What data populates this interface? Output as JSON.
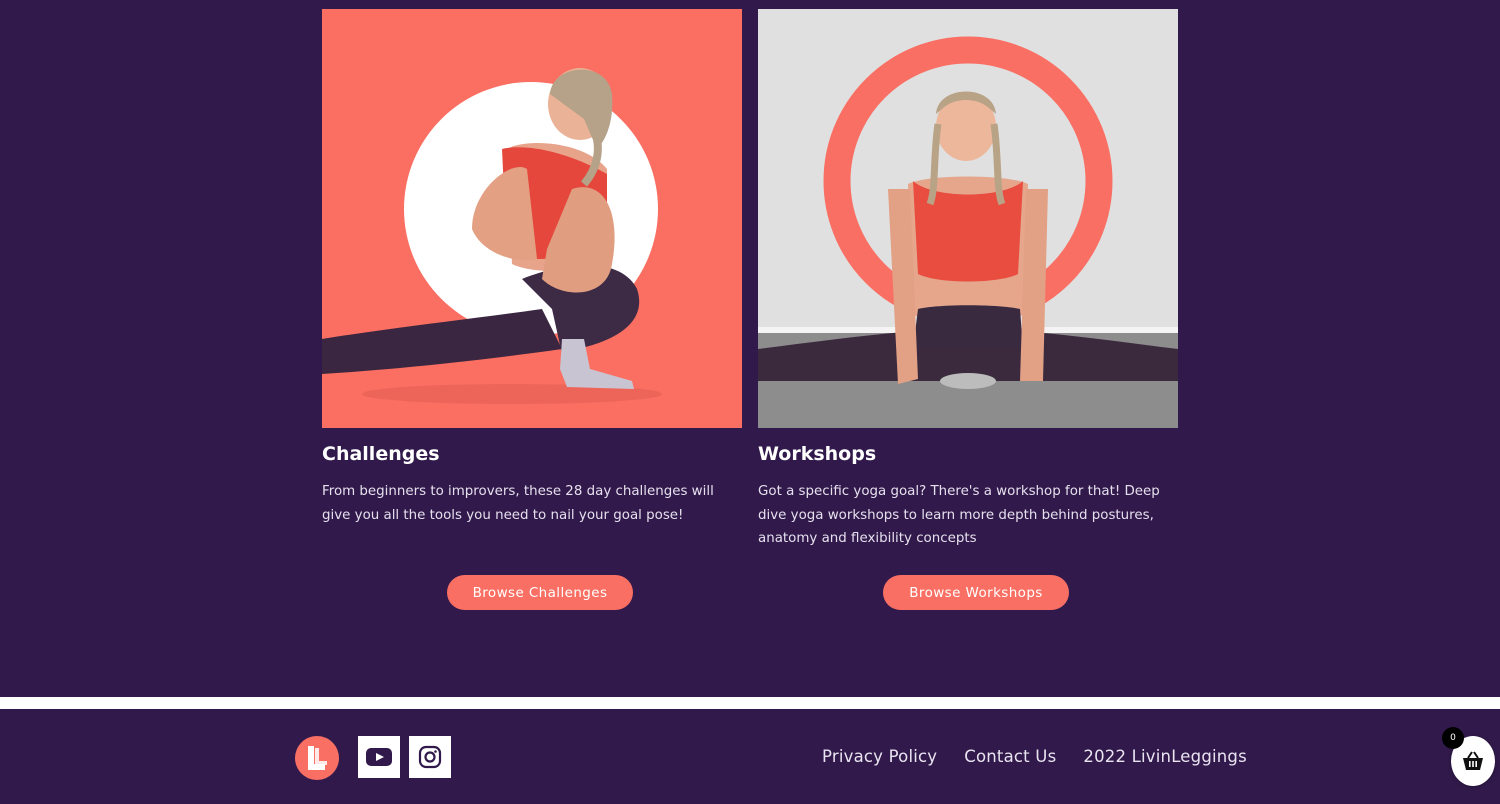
{
  "cards": [
    {
      "title": "Challenges",
      "description": "From beginners to improvers, these 28 day challenges will give you all the tools you need to nail your goal pose!",
      "button_label": "Browse Challenges"
    },
    {
      "title": "Workshops",
      "description": "Got a specific yoga goal? There's a workshop for that! Deep dive yoga workshops to learn more depth behind postures, anatomy and flexibility concepts",
      "button_label": "Browse Workshops"
    }
  ],
  "footer": {
    "logo_icon": "livinleggings-logo",
    "social": [
      {
        "name": "youtube-icon"
      },
      {
        "name": "instagram-icon"
      }
    ],
    "links": [
      "Privacy Policy",
      "Contact Us"
    ],
    "copyright": "2022 LivinLeggings"
  },
  "cart": {
    "count": "0",
    "icon": "basket-icon"
  },
  "colors": {
    "background": "#311a4b",
    "accent": "#f96f63",
    "divider": "#ffffff"
  }
}
